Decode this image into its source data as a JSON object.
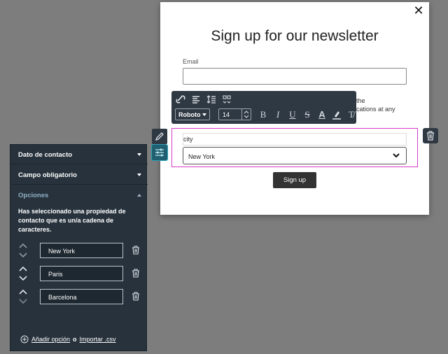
{
  "modal": {
    "close_glyph": "✕",
    "title": "Sign up for our newsletter",
    "email_label": "Email",
    "consent_line1": "the",
    "consent_line2": "cations at any",
    "city_label": "city",
    "city_value": "New York",
    "signup_label": "Sign up"
  },
  "toolbar": {
    "font": "Roboto",
    "size": "14",
    "icons": [
      "link-icon",
      "align-icon",
      "line-height-icon",
      "merge-tags-icon",
      "bold-icon",
      "italic-icon",
      "underline-icon",
      "strikethrough-icon",
      "text-color-icon",
      "highlight-icon",
      "clear-format-icon"
    ]
  },
  "panel": {
    "section1": "Dato de contacto",
    "section2": "Campo obligatorio",
    "section3": "Opciones",
    "description": "Has seleccionado una propiedad de contacto que es un/a cadena de caracteres.",
    "options": [
      "New York",
      "Paris",
      "Barcelona"
    ],
    "add_option": "Añadir opción",
    "or_text": "o",
    "import_csv": "Importar .csv"
  },
  "colors": {
    "panel_bg": "#27323c",
    "accent_selection": "#d63bc4",
    "accent_teal": "#2aa3b8",
    "section_active": "#8fb0c4"
  }
}
